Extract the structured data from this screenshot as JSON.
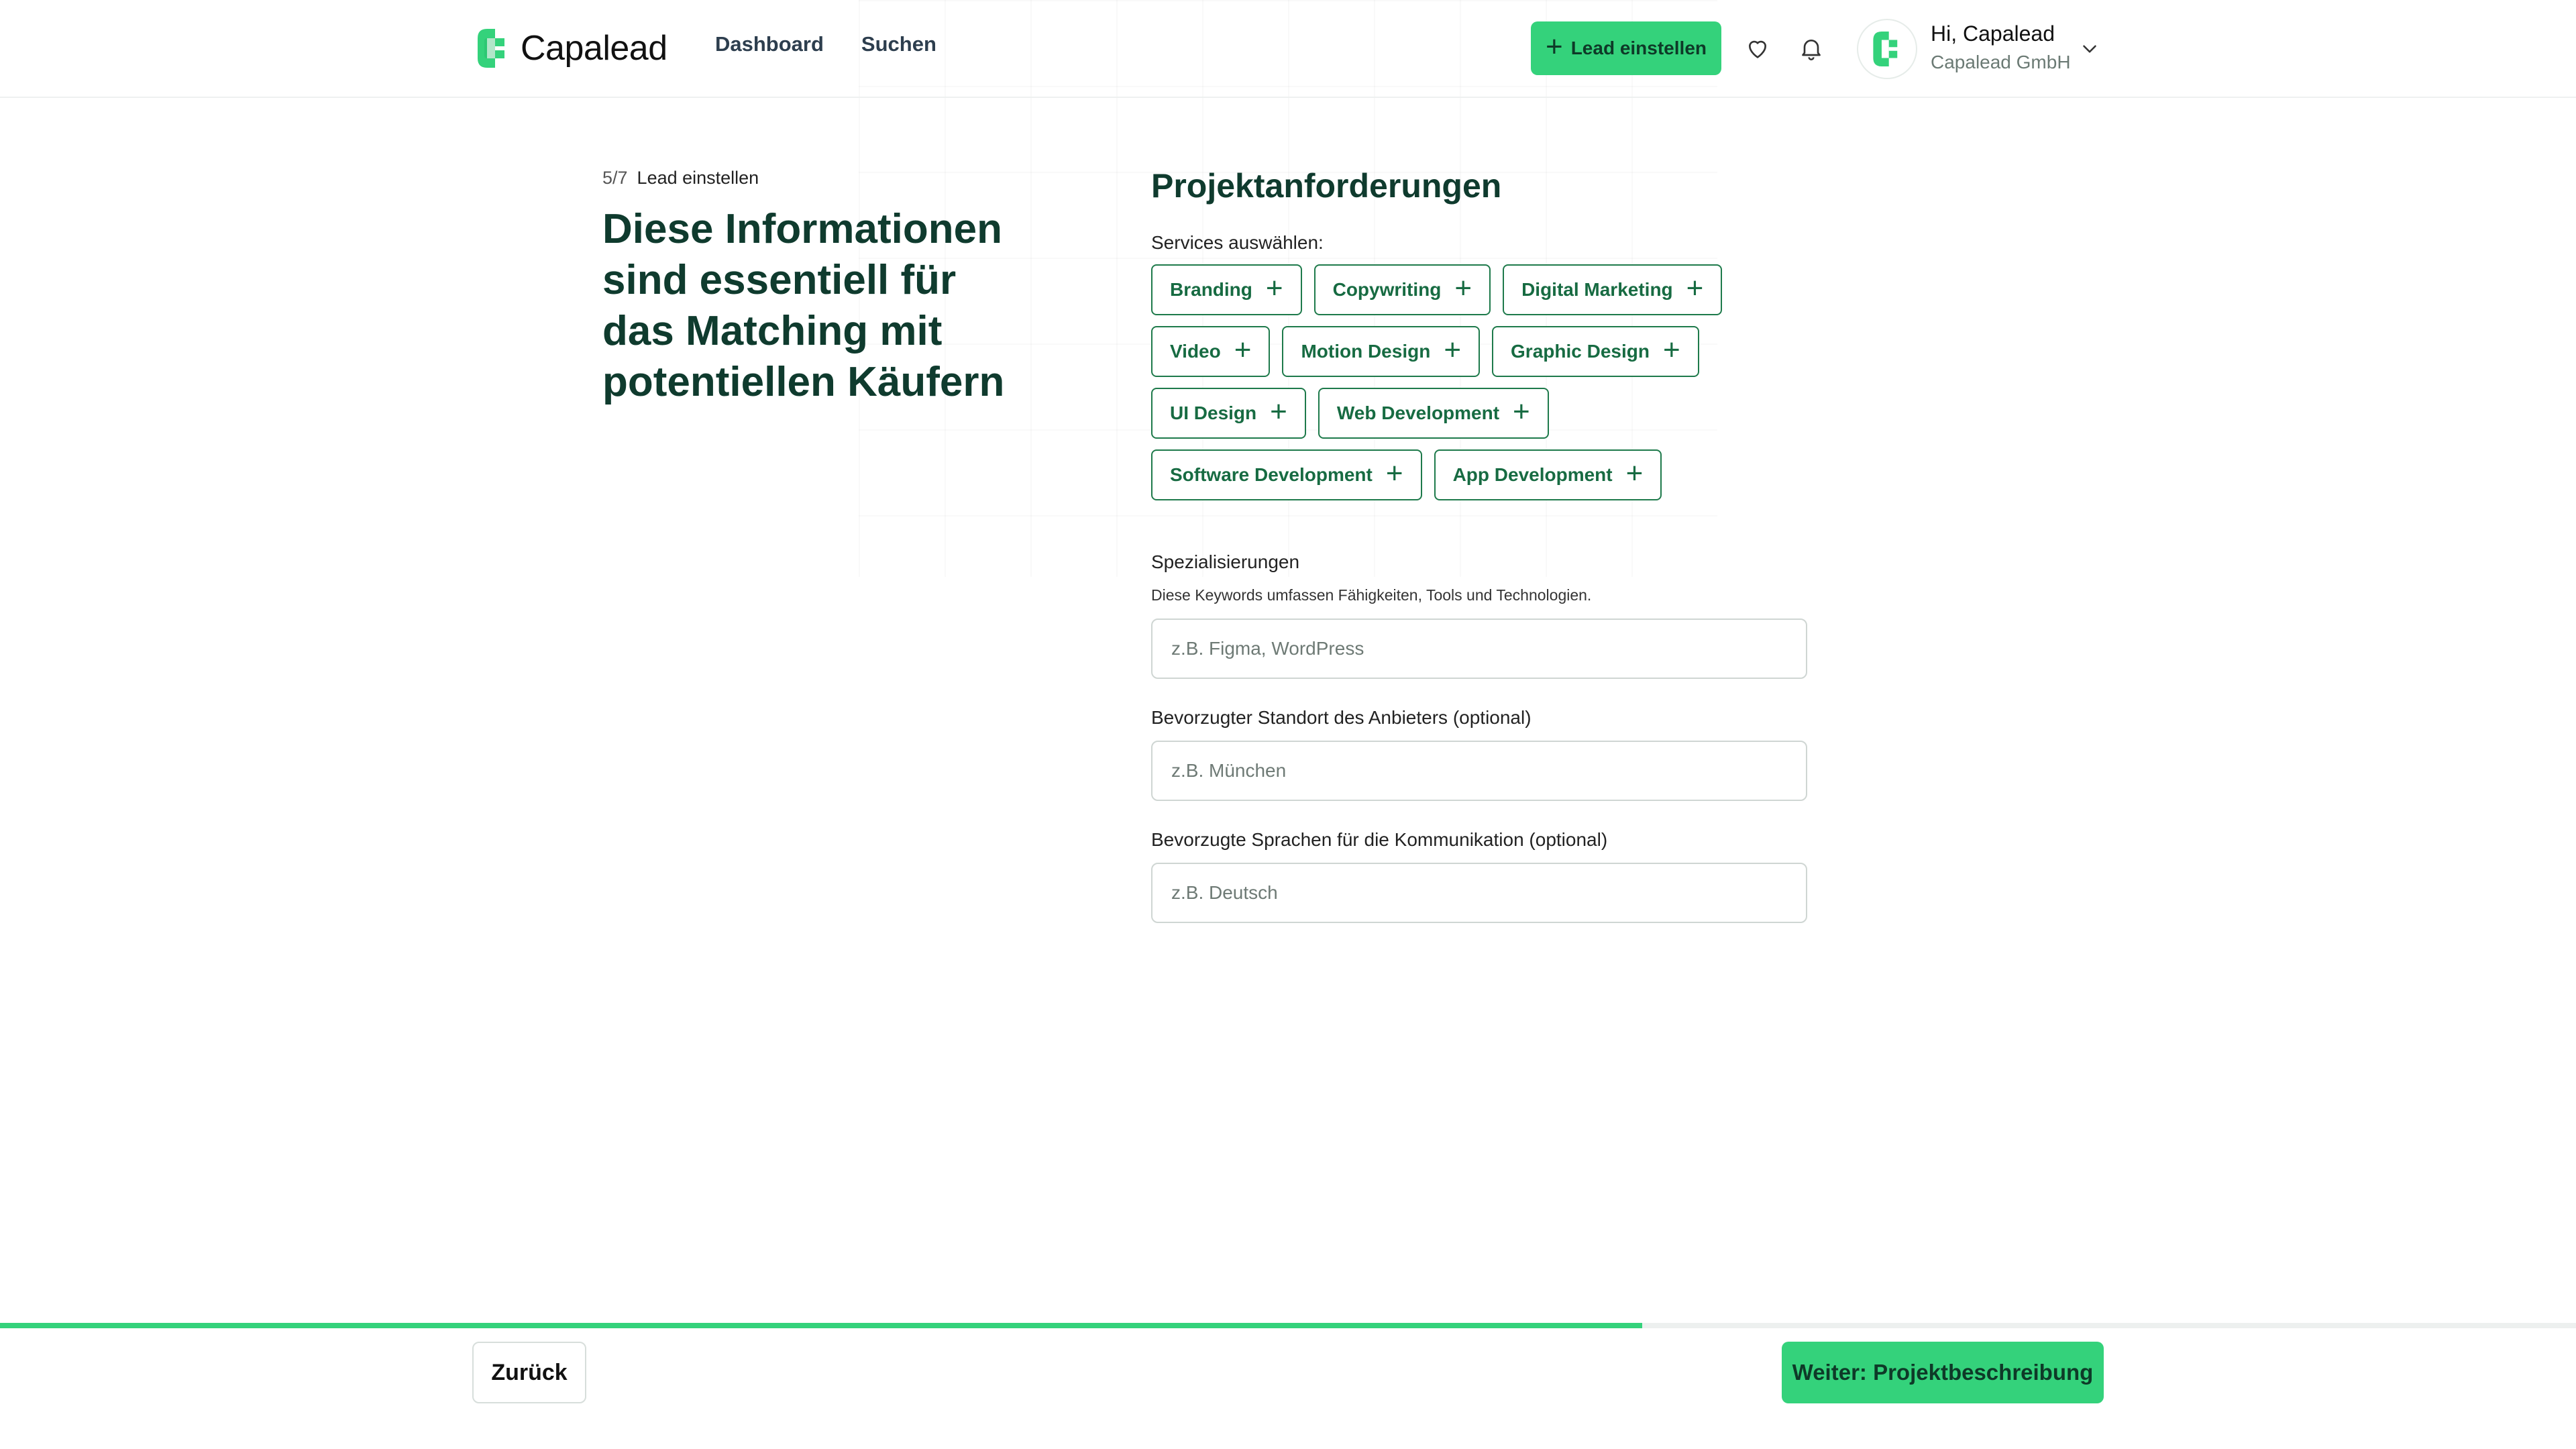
{
  "colors": {
    "accent": "#34D27B",
    "chip_border": "#1E7A4B",
    "heading": "#0F3B2E"
  },
  "brand": {
    "name": "Capalead",
    "logo_icon": "capalead-logo-icon"
  },
  "nav": [
    {
      "label": "Dashboard"
    },
    {
      "label": "Suchen"
    }
  ],
  "header": {
    "create_lead_label": "Lead einstellen",
    "create_icon": "plus-icon",
    "favorites_icon": "heart-icon",
    "notifications_icon": "bell-icon",
    "user_greeting": "Hi, Capalead",
    "user_company": "Capalead GmbH",
    "menu_icon": "chevron-down-icon"
  },
  "step": {
    "progress": "5/7",
    "label": "Lead einstellen"
  },
  "headline": "Diese Informationen sind essentiell für das Matching mit potentiellen Käufern",
  "section_title": "Projektanforderungen",
  "services": {
    "label": "Services auswählen:",
    "rows": [
      [
        "Branding",
        "Copywriting",
        "Digital Marketing"
      ],
      [
        "Video",
        "Motion Design",
        "Graphic Design"
      ],
      [
        "UI Design",
        "Web Development"
      ],
      [
        "Software Development",
        "App Development"
      ]
    ],
    "add_icon": "plus-icon"
  },
  "specializations": {
    "label": "Spezialisierungen",
    "help": "Diese Keywords umfassen Fähigkeiten, Tools und Technologien.",
    "placeholder": "z.B. Figma, WordPress",
    "value": ""
  },
  "location": {
    "label": "Bevorzugter Standort des Anbieters (optional)",
    "placeholder": "z.B. München",
    "value": ""
  },
  "languages": {
    "label": "Bevorzugte Sprachen für die Kommunikation (optional)",
    "placeholder": "z.B. Deutsch",
    "value": ""
  },
  "progress_fraction": 0.6375,
  "footer": {
    "back_label": "Zurück",
    "next_label": "Weiter: Projektbeschreibung"
  }
}
